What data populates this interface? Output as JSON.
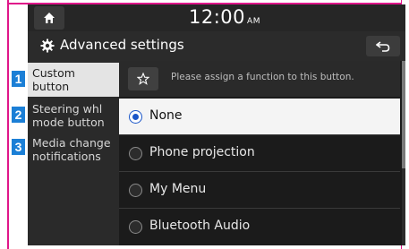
{
  "status_bar": {
    "time": "12:00",
    "ampm": "AM"
  },
  "title_bar": {
    "title": "Advanced settings"
  },
  "sidebar": {
    "items": [
      {
        "label": "Custom\nbutton",
        "active": true
      },
      {
        "label": "Steering whl\nmode button",
        "active": false
      },
      {
        "label": "Media change\nnotifications",
        "active": false
      }
    ]
  },
  "content": {
    "assign_hint": "Please assign a function to this button.",
    "options": [
      {
        "label": "None",
        "selected": true
      },
      {
        "label": "Phone projection",
        "selected": false
      },
      {
        "label": "My Menu",
        "selected": false
      },
      {
        "label": "Bluetooth Audio",
        "selected": false
      }
    ]
  },
  "callouts": [
    "1",
    "2",
    "3"
  ],
  "colors": {
    "callout_blue": "#1b7fd6",
    "frame_pink": "#e0168a",
    "radio_selected": "#1a56c8",
    "selected_row_bg": "#f4f4f4"
  }
}
